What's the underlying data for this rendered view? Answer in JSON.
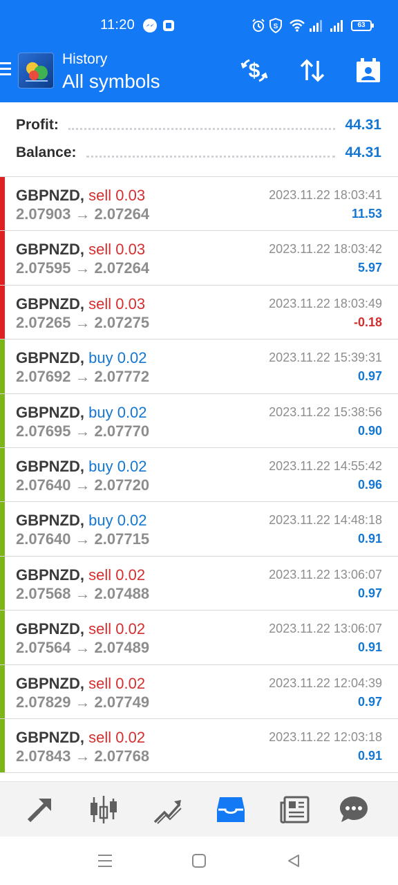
{
  "status_bar": {
    "time": "11:20",
    "battery": "63"
  },
  "header": {
    "subtitle": "History",
    "title": "All symbols"
  },
  "summary": {
    "profit_label": "Profit:",
    "profit_value": "44.31",
    "balance_label": "Balance:",
    "balance_value": "44.31"
  },
  "colors": {
    "header_blue": "#1479f5",
    "sell_red": "#d32f2f",
    "buy_blue": "#1377d2",
    "bar_red": "#e02020",
    "bar_green": "#7cb518"
  },
  "trades": [
    {
      "symbol": "GBPNZD,",
      "type": "sell 0.03",
      "side": "sell",
      "open": "2.07903",
      "arrow": "→",
      "close": "2.07264",
      "time": "2023.11.22 18:03:41",
      "profit": "11.53",
      "bar": "red"
    },
    {
      "symbol": "GBPNZD,",
      "type": "sell 0.03",
      "side": "sell",
      "open": "2.07595",
      "arrow": "→",
      "close": "2.07264",
      "time": "2023.11.22 18:03:42",
      "profit": "5.97",
      "bar": "red"
    },
    {
      "symbol": "GBPNZD,",
      "type": "sell 0.03",
      "side": "sell",
      "open": "2.07265",
      "arrow": "→",
      "close": "2.07275",
      "time": "2023.11.22 18:03:49",
      "profit": "-0.18",
      "bar": "red"
    },
    {
      "symbol": "GBPNZD,",
      "type": "buy 0.02",
      "side": "buy",
      "open": "2.07692",
      "arrow": "→",
      "close": "2.07772",
      "time": "2023.11.22 15:39:31",
      "profit": "0.97",
      "bar": "green"
    },
    {
      "symbol": "GBPNZD,",
      "type": "buy 0.02",
      "side": "buy",
      "open": "2.07695",
      "arrow": "→",
      "close": "2.07770",
      "time": "2023.11.22 15:38:56",
      "profit": "0.90",
      "bar": "green"
    },
    {
      "symbol": "GBPNZD,",
      "type": "buy 0.02",
      "side": "buy",
      "open": "2.07640",
      "arrow": "→",
      "close": "2.07720",
      "time": "2023.11.22 14:55:42",
      "profit": "0.96",
      "bar": "green"
    },
    {
      "symbol": "GBPNZD,",
      "type": "buy 0.02",
      "side": "buy",
      "open": "2.07640",
      "arrow": "→",
      "close": "2.07715",
      "time": "2023.11.22 14:48:18",
      "profit": "0.91",
      "bar": "green"
    },
    {
      "symbol": "GBPNZD,",
      "type": "sell 0.02",
      "side": "sell",
      "open": "2.07568",
      "arrow": "→",
      "close": "2.07488",
      "time": "2023.11.22 13:06:07",
      "profit": "0.97",
      "bar": "green"
    },
    {
      "symbol": "GBPNZD,",
      "type": "sell 0.02",
      "side": "sell",
      "open": "2.07564",
      "arrow": "→",
      "close": "2.07489",
      "time": "2023.11.22 13:06:07",
      "profit": "0.91",
      "bar": "green"
    },
    {
      "symbol": "GBPNZD,",
      "type": "sell 0.02",
      "side": "sell",
      "open": "2.07829",
      "arrow": "→",
      "close": "2.07749",
      "time": "2023.11.22 12:04:39",
      "profit": "0.97",
      "bar": "green"
    },
    {
      "symbol": "GBPNZD,",
      "type": "sell 0.02",
      "side": "sell",
      "open": "2.07843",
      "arrow": "→",
      "close": "2.07768",
      "time": "2023.11.22 12:03:18",
      "profit": "0.91",
      "bar": "green"
    }
  ],
  "bottom_nav": [
    {
      "icon": "trade-icon"
    },
    {
      "icon": "candlestick-chart-icon"
    },
    {
      "icon": "trend-chart-icon"
    },
    {
      "icon": "history-inbox-icon",
      "active": true
    },
    {
      "icon": "news-icon"
    },
    {
      "icon": "chat-icon"
    }
  ]
}
